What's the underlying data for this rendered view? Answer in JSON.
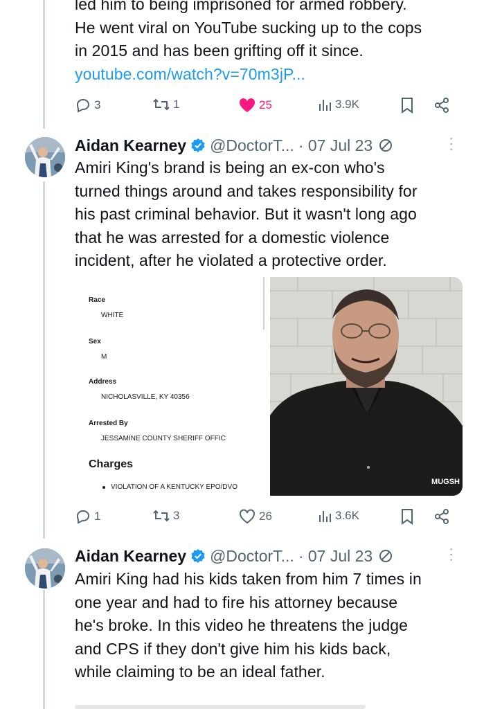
{
  "tweet1": {
    "lines": [
      "led him to being imprisoned for armed robbery.",
      "He went viral on YouTube sucking up to the cops",
      "in 2015 and has been grifting off it since."
    ],
    "link": "youtube.com/watch?v=70m3jP...",
    "replies": "3",
    "reposts": "1",
    "likes": "25",
    "views": "3.9K"
  },
  "tweet2": {
    "name": "Aidan Kearney",
    "handle": "@DoctorT...",
    "date": "· 07 Jul 23",
    "lines": [
      "Amiri King's brand is being an ex-con who's",
      "turned things around and takes responsibility for",
      "his past criminal behavior. But it wasn't long ago",
      "that he was arrested for a domestic violence",
      "incident, after he violated a protective order."
    ],
    "card": {
      "race_label": "Race",
      "race_value": "WHITE",
      "sex_label": "Sex",
      "sex_value": "M",
      "address_label": "Address",
      "address_value": "NICHOLASVILLE, KY 40356",
      "arrested_label": "Arrested By",
      "arrested_value": "JESSAMINE COUNTY SHERIFF OFFIC",
      "charges_label": "Charges",
      "charge_item": "VIOLATION OF A KENTUCKY EPO/DVO",
      "watermark": "MUGSH"
    },
    "replies": "1",
    "reposts": "3",
    "likes": "26",
    "views": "3.6K"
  },
  "tweet3": {
    "name": "Aidan Kearney",
    "handle": "@DoctorT...",
    "date": "· 07 Jul 23",
    "lines": [
      "Amiri King had his kids taken from him 7 times in",
      "one year and had to fire his attorney because",
      "he's broke. In this video he threatens the judge",
      "and CPS if they don't give him his kids back,",
      "while claiming to be an ideal father."
    ]
  },
  "colors": {
    "link": "#1d9bf0",
    "like_active": "#f91880",
    "muted": "#536471",
    "verified": "#1d9bf0"
  }
}
